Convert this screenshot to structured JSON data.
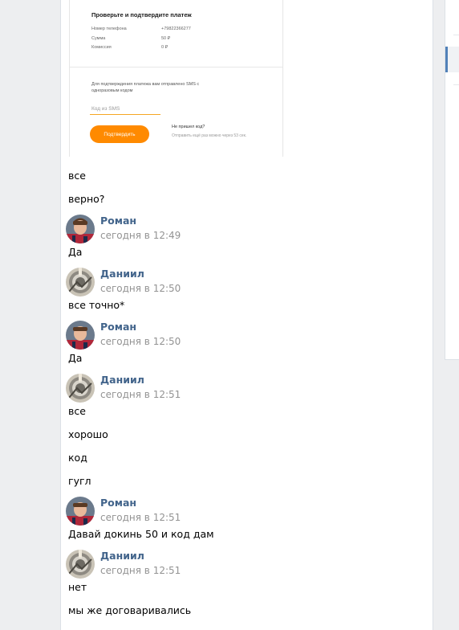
{
  "payment_card": {
    "title": "Проверьте и подтвердите платеж",
    "rows": [
      {
        "label": "Номер телефона",
        "value": "+79822366277"
      },
      {
        "label": "Сумма",
        "value": "50 ₽"
      },
      {
        "label": "Комиссия",
        "value": "0 ₽"
      }
    ],
    "note": "Для подтверждения платежа вам отправлено SMS с одноразовым кодом",
    "sms_placeholder": "Код из SMS",
    "confirm_button": "Подтвердить",
    "no_code": "Не пришел код?",
    "resend_text": "Отправить ещё раз можно через 53 сек."
  },
  "messages": [
    {
      "text": "все"
    },
    {
      "text": "верно?"
    },
    {
      "author": "Роман",
      "time": "сегодня в 12:49",
      "text": "Да"
    },
    {
      "author": "Даниил",
      "time": "сегодня в 12:50",
      "text": "все точно*"
    },
    {
      "author": "Роман",
      "time": "сегодня в 12:50",
      "text": "Да"
    },
    {
      "author": "Даниил",
      "time": "сегодня в 12:51",
      "text": "все"
    },
    {
      "text": "хорошо"
    },
    {
      "text": "код"
    },
    {
      "text": "гугл"
    },
    {
      "author": "Роман",
      "time": "сегодня в 12:51",
      "text": "Давай докинь 50 и код дам"
    },
    {
      "author": "Даниил",
      "time": "сегодня в 12:51",
      "text": "нет"
    },
    {
      "text": "мы же договаривались"
    }
  ],
  "colors": {
    "author": "#42648b",
    "time": "#939393",
    "confirm_button": "#ff8a00",
    "background": "#edeef0"
  }
}
